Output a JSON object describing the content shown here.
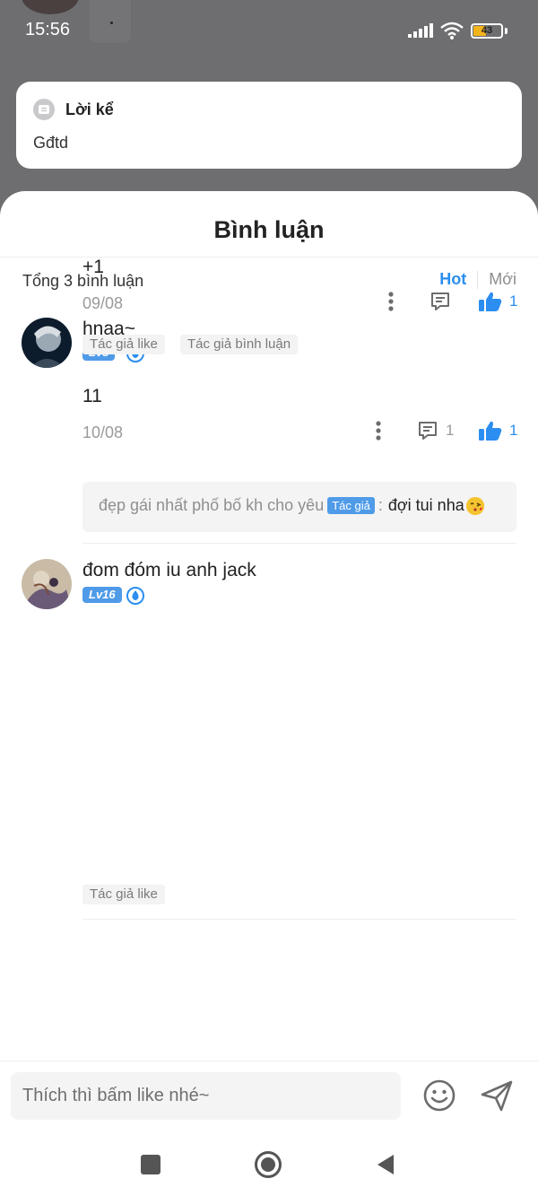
{
  "status_bar": {
    "time": "15:56",
    "battery": "43"
  },
  "story": {
    "title": "Lời kể",
    "text": "Gđtd"
  },
  "sheet": {
    "title": "Bình luận",
    "total": "Tổng 3 bình luận",
    "sort_tabs": [
      {
        "label": "Hot",
        "active": true
      },
      {
        "label": "Mới",
        "active": false
      }
    ]
  },
  "comments": [
    {
      "username": "hnaa~",
      "level": "Lv8",
      "text": "11",
      "date": "10/08",
      "reply_count": "1",
      "like_count": "1",
      "tags": [
        "Tác giả like",
        "Tác giả bình luận"
      ],
      "reply": {
        "text": "đẹp gái nhất phố bố kh cho yêu",
        "author_tag": "Tác giả",
        "separator": ":",
        "content": "đợi tui nha"
      }
    },
    {
      "username": "đom đóm iu anh jack",
      "level": "Lv16",
      "text": "+1",
      "date": "09/08",
      "reply_count": "",
      "like_count": "1",
      "tags": [
        "Tác giả like"
      ]
    }
  ],
  "composer": {
    "placeholder": "Thích thì bấm like nhé~"
  },
  "colors": {
    "accent": "#2b8ef0",
    "level_badge": "#4f9be8",
    "scrim": "#6e6e70"
  },
  "icons": {
    "story": "document-icon",
    "reply": "comment-icon",
    "like": "thumbs-up-icon",
    "more": "more-vertical-icon",
    "emoji": "smiley-icon",
    "send": "send-icon",
    "nav": [
      "square-icon",
      "circle-icon",
      "back-triangle-icon"
    ]
  }
}
